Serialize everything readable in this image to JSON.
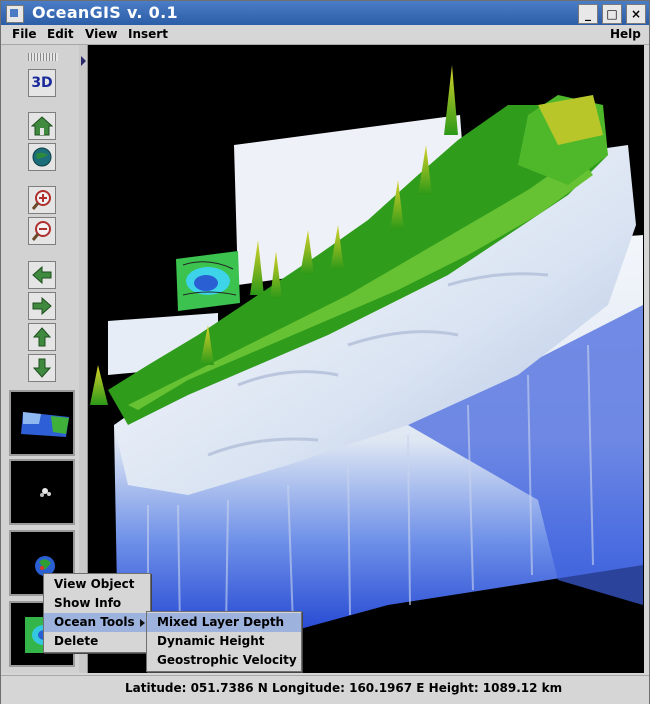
{
  "window": {
    "title": "OceanGIS v. 0.1",
    "controls": {
      "minimize": "_",
      "maximize": "□",
      "close": "×"
    }
  },
  "menubar": {
    "items": [
      "File",
      "Edit",
      "View",
      "Insert",
      "Help"
    ]
  },
  "toolbar": {
    "mode_3d_label": "3D",
    "tools": [
      {
        "name": "home-icon"
      },
      {
        "name": "globe-icon"
      },
      {
        "name": "zoom-in-icon"
      },
      {
        "name": "zoom-out-icon"
      },
      {
        "name": "arrow-left-icon"
      },
      {
        "name": "arrow-right-icon"
      },
      {
        "name": "arrow-up-icon"
      },
      {
        "name": "arrow-down-icon"
      }
    ]
  },
  "context_menu": {
    "items": [
      "View Object",
      "Show Info",
      "Ocean Tools",
      "Delete"
    ],
    "selected": "Ocean Tools"
  },
  "submenu": {
    "items": [
      "Mixed Layer Depth",
      "Dynamic Height",
      "Geostrophic Velocity"
    ],
    "selected": "Mixed Layer Depth"
  },
  "statusbar": {
    "text": "Latitude: 051.7386 N Longitude: 160.1967 E Height: 1089.12 km"
  },
  "colors": {
    "titlebar": "#2c5ea8",
    "selection": "#9db3dd",
    "terrain_green": "#2e9a1a",
    "terrain_yellow": "#d4cf2a",
    "terrain_white": "#e9eef7",
    "terrain_blue": "#1c3fd0"
  }
}
